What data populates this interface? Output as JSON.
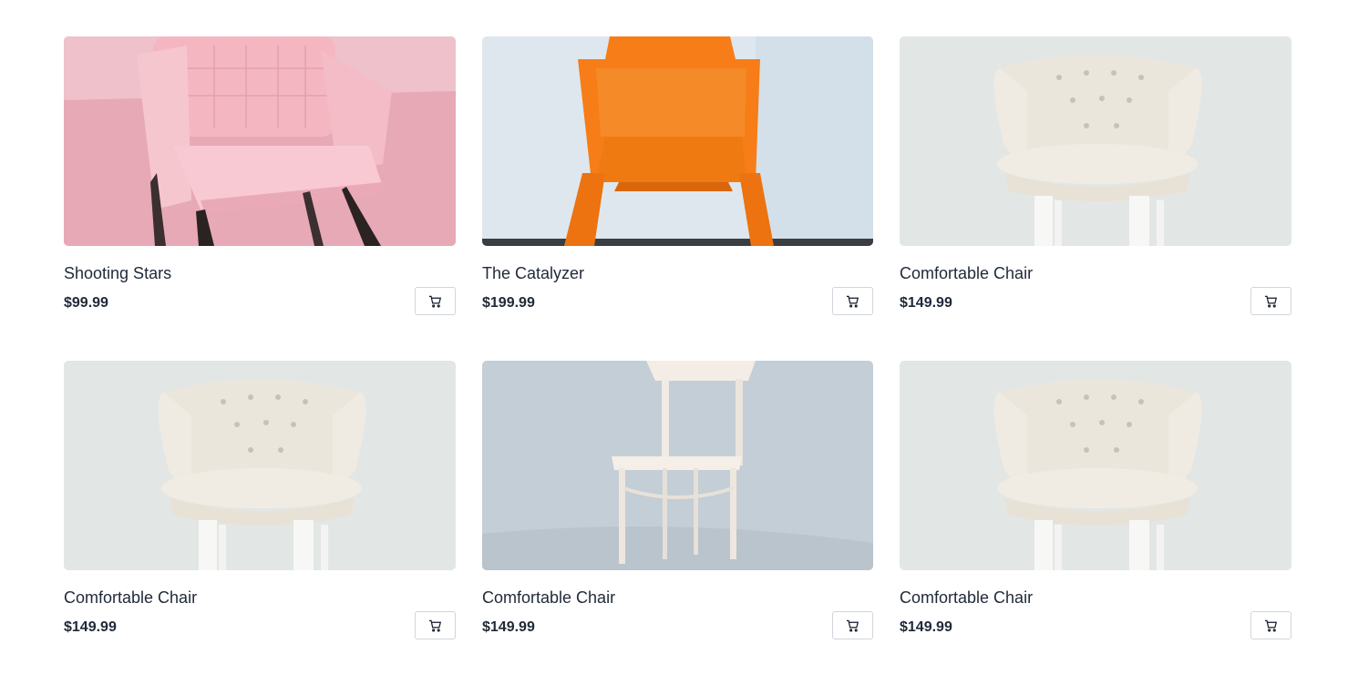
{
  "products": [
    {
      "name": "Shooting Stars",
      "price": "$99.99",
      "image": "pink-armchair",
      "cart_icon": "cart-icon"
    },
    {
      "name": "The Catalyzer",
      "price": "$199.99",
      "image": "orange-chair",
      "cart_icon": "cart-icon"
    },
    {
      "name": "Comfortable Chair",
      "price": "$149.99",
      "image": "white-tufted-chair",
      "cart_icon": "cart-icon"
    },
    {
      "name": "Comfortable Chair",
      "price": "$149.99",
      "image": "white-tufted-chair",
      "cart_icon": "cart-icon"
    },
    {
      "name": "Comfortable Chair",
      "price": "$149.99",
      "image": "white-wooden-chair",
      "cart_icon": "cart-icon"
    },
    {
      "name": "Comfortable Chair",
      "price": "$149.99",
      "image": "white-tufted-chair",
      "cart_icon": "cart-icon"
    }
  ]
}
